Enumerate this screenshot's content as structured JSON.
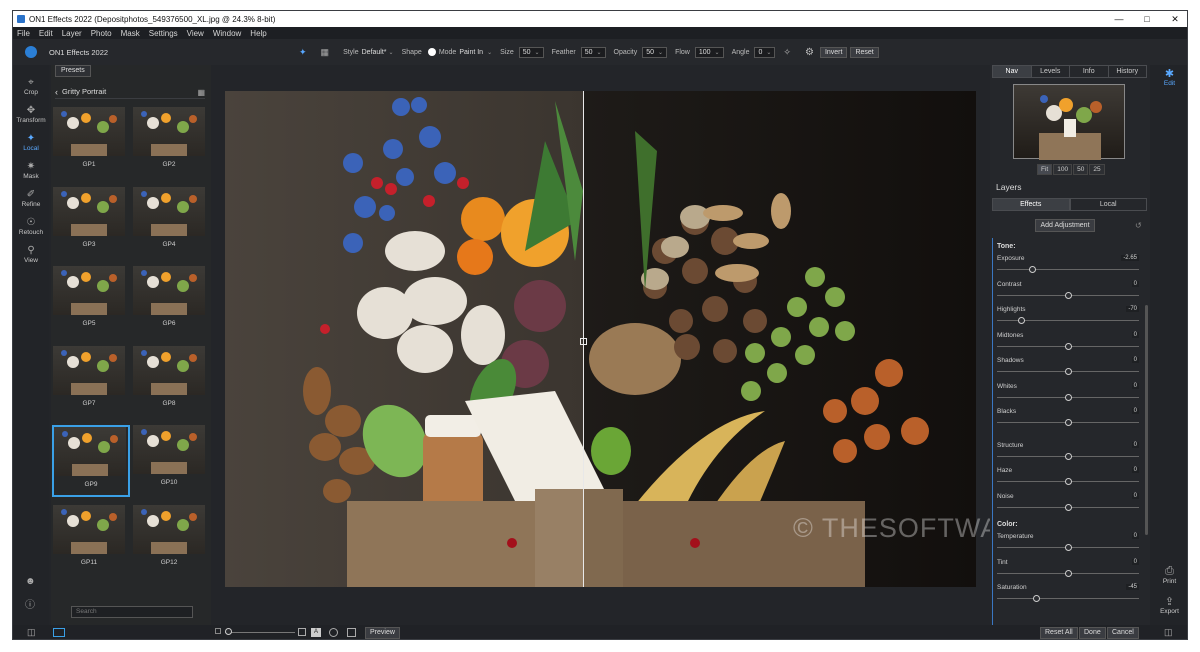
{
  "titlebar": {
    "title": "ON1 Effects 2022 (Depositphotos_549376500_XL.jpg @ 24.3% 8-bit)"
  },
  "menu": [
    "File",
    "Edit",
    "Layer",
    "Photo",
    "Mask",
    "Settings",
    "View",
    "Window",
    "Help"
  ],
  "toolbar": {
    "app_name": "ON1 Effects 2022",
    "style_label": "Style",
    "style_value": "Default*",
    "shape_label": "Shape",
    "mode_label": "Mode",
    "mode_value": "Paint In",
    "size_label": "Size",
    "size_value": "50",
    "feather_label": "Feather",
    "feather_value": "50",
    "opacity_label": "Opacity",
    "opacity_value": "50",
    "flow_label": "Flow",
    "flow_value": "100",
    "angle_label": "Angle",
    "angle_value": "0",
    "invert_label": "Invert",
    "reset_label": "Reset"
  },
  "left_rail": [
    {
      "label": "Crop",
      "icon": "crop-icon"
    },
    {
      "label": "Transform",
      "icon": "transform-icon"
    },
    {
      "label": "Local",
      "icon": "local-brush-icon",
      "active": true
    },
    {
      "label": "Mask",
      "icon": "mask-icon"
    },
    {
      "label": "Refine",
      "icon": "refine-icon"
    },
    {
      "label": "Retouch",
      "icon": "retouch-icon"
    },
    {
      "label": "View",
      "icon": "view-icon"
    }
  ],
  "presets": {
    "tab": "Presets",
    "category": "Gritty Portrait",
    "items": [
      "GP1",
      "GP2",
      "GP3",
      "GP4",
      "GP5",
      "GP6",
      "GP7",
      "GP8",
      "GP9",
      "GP10",
      "GP11",
      "GP12"
    ],
    "selected": "GP9",
    "search_placeholder": "Search"
  },
  "watermark": "© THESOFTWARE.SHOP",
  "nav": {
    "tabs": [
      "Nav",
      "Levels",
      "Info",
      "History"
    ],
    "active": "Nav",
    "zoom": [
      "Fit",
      "100",
      "50",
      "25"
    ]
  },
  "layers": {
    "title": "Layers",
    "tabs": [
      "Effects",
      "Local"
    ],
    "active_tab": "Effects",
    "add_adjustment": "Add Adjustment",
    "tone_label": "Tone:",
    "tone": [
      {
        "name": "Exposure",
        "value": "-2.65",
        "pos": 0.25
      },
      {
        "name": "Contrast",
        "value": "0",
        "pos": 0.5
      },
      {
        "name": "Highlights",
        "value": "-70",
        "pos": 0.17
      },
      {
        "name": "Midtones",
        "value": "0",
        "pos": 0.5
      },
      {
        "name": "Shadows",
        "value": "0",
        "pos": 0.5
      },
      {
        "name": "Whites",
        "value": "0",
        "pos": 0.5
      },
      {
        "name": "Blacks",
        "value": "0",
        "pos": 0.5
      }
    ],
    "detail": [
      {
        "name": "Structure",
        "value": "0",
        "pos": 0.5
      },
      {
        "name": "Haze",
        "value": "0",
        "pos": 0.5
      },
      {
        "name": "Noise",
        "value": "0",
        "pos": 0.5
      }
    ],
    "color_label": "Color:",
    "color": [
      {
        "name": "Temperature",
        "value": "0",
        "pos": 0.5
      },
      {
        "name": "Tint",
        "value": "0",
        "pos": 0.5
      },
      {
        "name": "Saturation",
        "value": "-45",
        "pos": 0.28
      }
    ]
  },
  "right_rail": {
    "edit": "Edit",
    "print": "Print",
    "export": "Export"
  },
  "bottom": {
    "preview": "Preview",
    "reset_all": "Reset All",
    "done": "Done",
    "cancel": "Cancel"
  }
}
